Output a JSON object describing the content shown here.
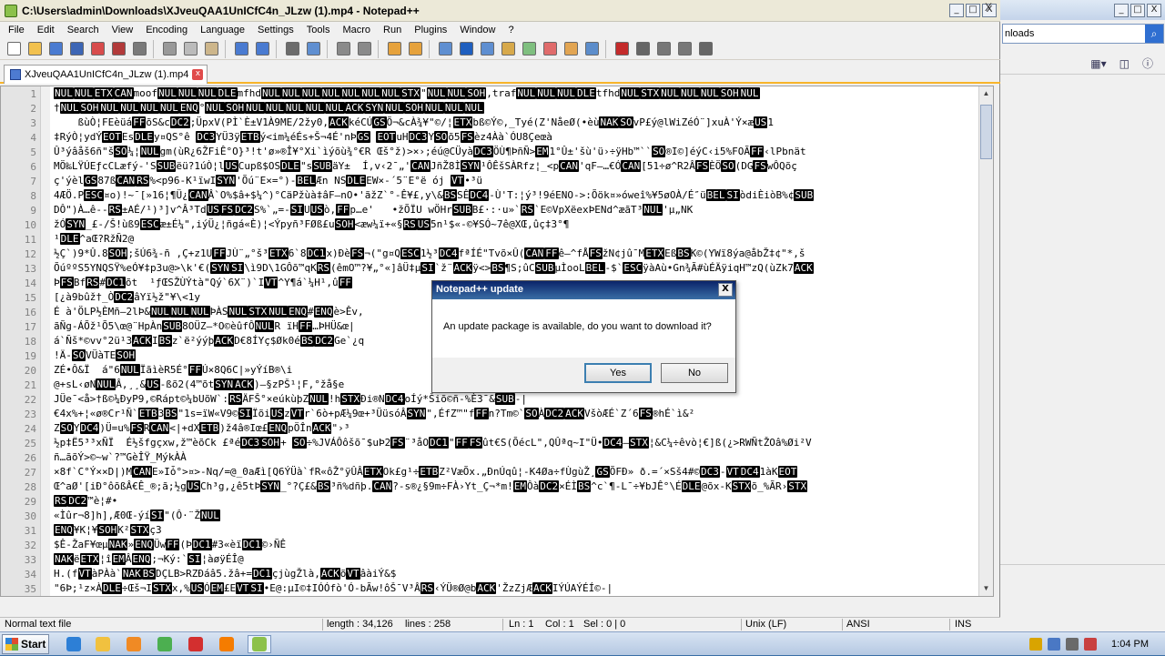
{
  "window": {
    "title": "C:\\Users\\admin\\Downloads\\XJveuQAA1UnICfC4n_JLzw (1).mp4 - Notepad++",
    "controls": {
      "minimize": "_",
      "maximize": "□",
      "close": "X"
    }
  },
  "menu": [
    "File",
    "Edit",
    "Search",
    "View",
    "Encoding",
    "Language",
    "Settings",
    "Tools",
    "Macro",
    "Run",
    "Plugins",
    "Window",
    "?"
  ],
  "menu_close": "X",
  "toolbar": {
    "icons": [
      "new-file-icon",
      "open-file-icon",
      "save-icon",
      "save-all-icon",
      "close-icon",
      "close-all-icon",
      "print-icon",
      "cut-icon",
      "copy-icon",
      "paste-icon",
      "undo-icon",
      "redo-icon",
      "find-icon",
      "replace-icon",
      "zoom-in-icon",
      "zoom-out-icon",
      "sync-v-icon",
      "sync-h-icon",
      "wrap-icon",
      "all-chars-icon",
      "indent-guide-icon",
      "udl-icon",
      "doc-map-icon",
      "function-list-icon",
      "folder-workspace-icon",
      "monitor-icon",
      "record-macro-icon",
      "stop-macro-icon",
      "play-macro-icon",
      "play-multiple-icon",
      "save-macro-icon"
    ]
  },
  "tab": {
    "label": "XJveuQAA1UnICfC4n_JLzw (1).mp4",
    "close": "x"
  },
  "editor": {
    "lines": [
      {
        "n": "1",
        "t": [
          [
            "NUL",
            "c"
          ],
          [
            "NUL",
            "c"
          ],
          [
            "ETX",
            "c"
          ],
          [
            "CAN",
            "c"
          ],
          [
            "moof",
            ""
          ],
          [
            "NUL",
            "c"
          ],
          [
            "NUL",
            "c"
          ],
          [
            "NUL",
            "c"
          ],
          [
            "DLE",
            "c"
          ],
          [
            "mfhd",
            ""
          ],
          [
            "NUL",
            "c"
          ],
          [
            "NUL",
            "c"
          ],
          [
            "NUL",
            "c"
          ],
          [
            "NUL",
            "c"
          ],
          [
            "NUL",
            "c"
          ],
          [
            "NUL",
            "c"
          ],
          [
            "NUL",
            "c"
          ],
          [
            "STX",
            "c"
          ],
          [
            "\"",
            ""
          ],
          [
            "NUL",
            "c"
          ],
          [
            "NUL",
            "c"
          ],
          [
            "SOH",
            "c"
          ],
          [
            ",traf",
            ""
          ],
          [
            "NUL",
            "c"
          ],
          [
            "NUL",
            "c"
          ],
          [
            "NUL",
            "c"
          ],
          [
            "DLE",
            "c"
          ],
          [
            "tfhd",
            ""
          ],
          [
            "NUL",
            "c"
          ],
          [
            "STX",
            "c"
          ],
          [
            "NUL",
            "c"
          ],
          [
            "NUL",
            "c"
          ],
          [
            "NUL",
            "c"
          ],
          [
            "SOH",
            "c"
          ],
          [
            "NUL",
            "c"
          ]
        ]
      },
      {
        "n": "2",
        "t": [
          [
            "†",
            ""
          ],
          [
            "NUL",
            "c"
          ],
          [
            "SOH",
            "c"
          ],
          [
            "NUL",
            "c"
          ],
          [
            "NUL",
            "c"
          ],
          [
            "NUL",
            "c"
          ],
          [
            "NUL",
            "c"
          ],
          [
            "ENQ",
            "c"
          ],
          [
            "°",
            ""
          ],
          [
            "NUL",
            "c"
          ],
          [
            "SOH",
            "c"
          ],
          [
            "NUL",
            "c"
          ],
          [
            "NUL",
            "c"
          ],
          [
            "NUL",
            "c"
          ],
          [
            "NUL",
            "c"
          ],
          [
            "NUL",
            "c"
          ],
          [
            "ACK",
            "c"
          ],
          [
            "SYN",
            "c"
          ],
          [
            "NUL",
            "c"
          ],
          [
            "SOH",
            "c"
          ],
          [
            "NUL",
            "c"
          ],
          [
            "NUL",
            "c"
          ],
          [
            "NUL",
            "c"
          ]
        ]
      },
      {
        "n": "3",
        "t": [
          [
            "    ßùÒ¦FEèüáFFõS&cDC2;ÜpxV(PÌ`È±V1À9ME/2žy0,ACKkéCÚGSÕ¬&cÀ¾¥\"©/¦ETXbß©Ý©,_Tyé(Z'NåeØ(•èùNAKSOvP£ý@lWiZéÓ¨]xuÀ'Ý×æUS1",
            ""
          ]
        ]
      },
      {
        "n": "4",
        "t": [
          [
            "‡RýÒ¦ydÝEOTEsDLEy¤QS°ê DC3YÜ3ÿETBý<im¼éÉs+Š¬4É'nÞGS EOTuHDC3YSOõ5FSèz4Àà`ÓU8Çeœà",
            ""
          ]
        ]
      },
      {
        "n": "5",
        "t": [
          [
            "Û³ýâåš6ñ\"šSO¼¦NULgm(ùR¿6ŽFiÊ°O}³!t'ø»®Î¥°Xi`ìýõù¾°€R Œš°ž)>×›;éú@CÜyàDC3ÖÙ¶ÞñÑ>EM1°Û±'šù'ü›÷ÿHb™``SO®I©]éýC‹i5%FOÃFF‹lPbnät",
            ""
          ]
        ]
      },
      {
        "n": "6",
        "t": [
          [
            "MÖ‰LŸÚEƒcCLæfý-'SSUBëü?1úÒ¦lUSCupß$OSDLE\"sSUBäY±  Í,v‹2¯„'CANJñŽ8ÌSYN¹ÔÊšSÀRfz¦_<pCAN'qF–…€ÓCAN[51÷ø^R2ÂFSÈÖSO(DGFSwÔQõç",
            ""
          ]
        ]
      },
      {
        "n": "7",
        "t": [
          [
            "ç'ýèlGS87ßCANRS%<p96-K¹ïwISYN'Õú¨E×=°)-BELÆn NSDLEEW×-´5¨E°ë ój VT•³ü",
            ""
          ]
        ]
      },
      {
        "n": "8",
        "t": [
          [
            "4ÆÖ.PESC¤o)!~¯[»16¦¶Ü¿CANÂ`O%$â+$¼^)°CäPžùà‡âF–nO•'ãžZ`°-Ê¥£,y\\&BSSÊDC4-Ù'T:¦ý³!9éENO->:Õök¤»óweî%¥5øOÀ/É″üBELSIòdiÈiòB%¢SUB",
            ""
          ]
        ]
      },
      {
        "n": "9",
        "t": [
          [
            "DÔ\")À…ê--RS±AÉ/¹)³]v^Â³TdUSFSDC2S%`„=-SIUUSò,FFp…e'   •žÕÏU wÖHrSUBB£·:·u»`RS`E©VpXëexÞENd^æãT³NUL'µ„NK",
            ""
          ]
        ]
      },
      {
        "n": "10",
        "t": [
          [
            "žÓSYN_£-/Š!ùß9ESCæ±É¼\",iýÜ¿¦ñgá«È)¦<Ýpyñ³FØß£uSOH<æw¼ï+«§RSUS5n¹$«-©¥SÓ~7ê@XŒ,ûç‡3°¶",
            ""
          ]
        ]
      },
      {
        "n": "11",
        "t": [
          [
            "¹DLE^aŒ?RžÑ2@",
            ""
          ]
        ]
      },
      {
        "n": "12",
        "t": [
          [
            "½Ç`)9*Û.8SOH;šÚ6¾-ñ ,Ç+z1UFFJÙ¨„°š³ETX6`8DC1x)ÐèFS¬(\"g¤QESC1½³DC4fªÍÉ\"Tvõ×Û(CANFFê–^fÅFSžN¢jû¯METXEßBSK©(YWï8ýa@åbŽ‡¢\"*,š",
            ""
          ]
        ]
      },
      {
        "n": "13",
        "t": [
          [
            "ÕúººS5YNQSŸ%eÓ¥‡p3u@>\\k'€(SYNSI\\ì9D\\1GÔõ™qKRS(êmO™?¥„°«]âÜ‡µSI`ž¨ACKÿ<>BS¶S;ûCSUBµÌooLBEL-$`ESCÿàAù•Gn¾Ã#ùÉÄÿiqH™zQ(ùZk7ACK",
            ""
          ]
        ]
      },
      {
        "n": "14",
        "t": [
          [
            "ÞFSBfRS#DC1õt  ¹ƒŒSŽÙÝtà\"Qý`6X¨)`IVT^Y¶á`¼H¹,ûFF",
            ""
          ]
        ]
      },
      {
        "n": "15",
        "t": [
          [
            "[¿à9bûž†_ÒDC2âYï½ž\"¥\\<1y",
            ""
          ]
        ]
      },
      {
        "n": "16",
        "t": [
          [
            "É à'ÖLP½ÈMñ–2lÞ&NULNULNULÞÀSNULSTXNULENQ#ENQè>Êv,",
            ""
          ]
        ]
      },
      {
        "n": "17",
        "t": [
          [
            "ãÑg-ÁÕž¹Õ5\\œ@¨HpÀnSUB8OÜZ–*O©èûfÔNULR ïHFF…ÞHÜ&œ|",
            ""
          ]
        ]
      },
      {
        "n": "18",
        "t": [
          [
            "á`Ñš*©vv°2ü¹3ACKIBSz`ë²ýýþACKD€8ÍYç$Øk0éBSDC2Ge`¿q",
            ""
          ]
        ]
      },
      {
        "n": "19",
        "t": [
          [
            "!Ä-SOVÜàTESOH",
            ""
          ]
        ]
      },
      {
        "n": "20",
        "t": [
          [
            "ZÉ•Ô&Ï  á\"6NULÏãìèR5É°FFÚ×8Q6C|»yÝíB®\\i",
            ""
          ]
        ]
      },
      {
        "n": "21",
        "t": [
          [
            "@+sL‹øNNULÂ,¸¸&US-ßõ2(4™õtSYNACK)–§zPŠ¹¦F,°žå§e",
            ""
          ]
        ]
      },
      {
        "n": "22",
        "t": [
          [
            "JÜe¯<å>†ß©¼ÐyP9,©Rápt©¼bUõW`:RSÄFŠ°×eúkùþZNUL!hSTXÐi®NDC4oÍý*Šiõ©ñ-%È3¯&SUB-|",
            ""
          ]
        ]
      },
      {
        "n": "23",
        "t": [
          [
            "€4x%+¦«ø®Cr¹Ñ`ETB3BS\"1s=ïW«V9©SIÏõiUSzVTr`6ò+pÆ¼9œ+³ÜüsóÂSYN\",ÉfZ™\"fFFn?Tm©`SOÀDC2ACKVšòÆÉ`Z´6FS®hÉ`ì&²",
            ""
          ]
        ]
      },
      {
        "n": "24",
        "t": [
          [
            "ZSOYDC4)Ü=u%FSRCAN<|+dXETB)ž4â®Iœ£ENQpÖÎnACK\"›³",
            ""
          ]
        ]
      },
      {
        "n": "25",
        "t": [
          [
            "½p‡Ë5³³xÑÏ  É½šfgçxw,ž™èõCk £ªéDC3SOH+ SO÷%JVÁÔôšõ¯$uÞ2FS¨³åODC1\"FFFSût€S(ÕécL\",QÛªq~I\"Ü•DC4—STX¦&C¼÷êvò¦€]ß(¿>RWÑtŽOâ%Øi²V",
            ""
          ]
        ]
      },
      {
        "n": "26",
        "t": [
          [
            "ñ…ãõÝ>©~w`?™GèÎŸ_MýkÀÀ",
            ""
          ]
        ]
      },
      {
        "n": "27",
        "t": [
          [
            "×8f`C°Ý××D|)MCANE»Iȱ°>¤>-Nq/=@_0aÆì[Q6ÝÜà`fR«ôŽ°ÿÛÂETXOk£g¹÷ETBZ²VæÕx.„ÐnÚqû¦-K4Øa÷fÙgùŽ¸GSÕFÐ» ð.=´×Sš4#©DC3-VTDC41àKEOT",
            ""
          ]
        ]
      },
      {
        "n": "28",
        "t": [
          [
            "Œ^aØ'[iÐ°ôõßÂ€Ê_®;ã;½gUSCh³g,¿ê5tÞSYN_°?Ç£&BS³ñ%dñþ.CAN?-s®¿§9m÷FÀ›Yt_Ç¬*m!EMÔàDC2×ÉÌBS^c`¶-L¯÷¥bJÊ°\\ÉDLE@õx-KSTXõ_%ÃR›STX",
            ""
          ]
        ]
      },
      {
        "n": "29",
        "t": [
          [
            "RSDC2™è¦#•",
            ""
          ]
        ]
      },
      {
        "n": "30",
        "t": [
          [
            "«Ìûr¬8]h],Æ0Œ-ýíSI\"(Ô·¨ŽNUL",
            ""
          ]
        ]
      },
      {
        "n": "31",
        "t": [
          [
            "ENQ¥K¦¥SOHK²STXç3",
            ""
          ]
        ]
      },
      {
        "n": "32",
        "t": [
          [
            "$Ê-ŽaF¥œµNAK»ENQÜwFF(ÞDC1#3«èïDC1©›ÑÊ",
            ""
          ]
        ]
      },
      {
        "n": "33",
        "t": [
          [
            "NAKëETX¦îEMÂENQ;¬Ký:`SI¦àøÿÉÎ@",
            ""
          ]
        ]
      },
      {
        "n": "34",
        "t": [
          [
            "H.(fVTàPÀà`NAKBSDÇLB>RZÐáâ5.žâ+=DC1çjùgŽlà,ACKõVTâàiÝ&$",
            ""
          ]
        ]
      },
      {
        "n": "35",
        "t": [
          [
            "\"6Þ;¹z×ÀDLE÷Œš¬ISTXx,%USÓEM£EVTSI•E@:µI©‡IÓÓfò'Ó-bÃw!ôŠ¯V³ÂRS‹ÝÜ®Ø@bACK'ŽzZjÆACKIÝÚAÝÉÍ©-|",
            ""
          ]
        ]
      }
    ]
  },
  "status": {
    "file_type": "Normal text file",
    "length": "length : 34,126",
    "lines": "lines : 258",
    "ln": "Ln : 1",
    "col": "Col : 1",
    "sel": "Sel : 0 | 0",
    "eol": "Unix (LF)",
    "encoding": "ANSI",
    "mode": "INS"
  },
  "dialog": {
    "title": "Notepad++ update",
    "message": "An update package is available, do you want to download it?",
    "yes": "Yes",
    "no": "No",
    "close": "X"
  },
  "background_window": {
    "address_text": "nloads",
    "controls": {
      "minimize": "_",
      "maximize": "□",
      "close": "X"
    }
  },
  "taskbar": {
    "start": "Start",
    "clock": "1:04 PM",
    "apps": [
      "ie-icon",
      "explorer-icon",
      "media-player-icon",
      "chrome-icon",
      "opera-icon",
      "vlc-icon",
      "notepadpp-icon"
    ]
  },
  "colors": {
    "tab_accent": "#f8b52a",
    "control_char_bg": "#000000",
    "dialog_title_bg": "#0a246a"
  }
}
